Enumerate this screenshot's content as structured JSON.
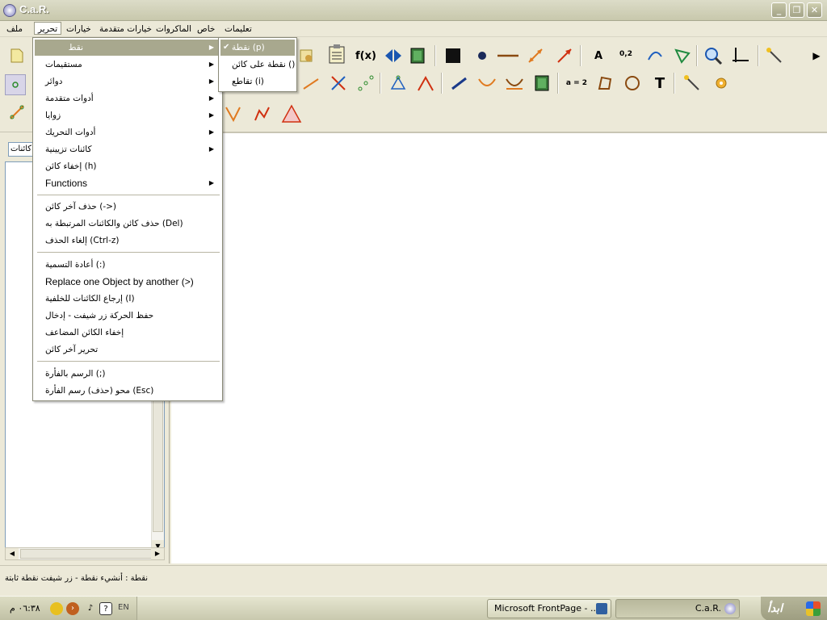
{
  "window": {
    "title": "C.a.R.",
    "buttons": {
      "minimize": "_",
      "maximize": "❐",
      "close": "✕"
    }
  },
  "menubar": {
    "items": [
      {
        "id": "file",
        "label": "ملف"
      },
      {
        "id": "edit",
        "label": "تحرير"
      },
      {
        "id": "options",
        "label": "خيارات"
      },
      {
        "id": "advanced_options",
        "label": "خيارات متقدمة"
      },
      {
        "id": "macros",
        "label": "الماكروات"
      },
      {
        "id": "special",
        "label": "خاص"
      },
      {
        "id": "help",
        "label": "تعليمات"
      }
    ]
  },
  "edit_menu": {
    "items": [
      {
        "label": "نقط",
        "submenu": true,
        "highlighted": true
      },
      {
        "label": "مستقيمات",
        "submenu": true
      },
      {
        "label": "دوائر",
        "submenu": true
      },
      {
        "label": "أدوات متقدمة",
        "submenu": true
      },
      {
        "label": "زوايا",
        "submenu": true
      },
      {
        "label": "أدوات التحريك",
        "submenu": true
      },
      {
        "label": "كائنات تزيينية",
        "submenu": true
      },
      {
        "label": "إخفاء كائن (h)"
      },
      {
        "label": "Functions",
        "submenu": true
      }
    ],
    "group2": [
      {
        "label": "حذف آخر كائن       (->)"
      },
      {
        "label": "حذف كائن والكائنات المرتبطة به (Del)"
      },
      {
        "label": "إلغاء الحذف       (Ctrl-z)"
      }
    ],
    "group3": [
      {
        "label": "أعادة التسمية (:)"
      },
      {
        "label": "Replace one Object by another (>)"
      },
      {
        "label": "إرجاع الكائنات للخلفية (I)"
      },
      {
        "label": "حفظ الحركة زر شيفت - إدخال"
      },
      {
        "label": "إخفاء الكائن المضاعف"
      },
      {
        "label": "تحرير آخر كائن"
      }
    ],
    "group4": [
      {
        "label": "الرسم بالفأرة (;)"
      },
      {
        "label": "محو (حذف) رسم الفأرة      (Esc)"
      }
    ]
  },
  "points_submenu": {
    "items": [
      {
        "label": "نقطة (p)",
        "checked": true,
        "highlighted": true
      },
      {
        "label": "نقطة على كائن ()"
      },
      {
        "label": "تقاطع (i)"
      }
    ]
  },
  "toolbar": {
    "fx_label": "f(x)",
    "label_tool": "A",
    "number_tool": "0,2",
    "equation_tool": "a = 2",
    "text_tool": "T",
    "more_arrow": "▶"
  },
  "left_panel": {
    "select_value": "كائنات"
  },
  "status": {
    "text": "نقطة : أنشيء نقطة - زر شيفت نقطة ثابتة"
  },
  "taskbar": {
    "start_label": "ابدأ",
    "clock": "٠٦:٣٨ م",
    "lang": "EN",
    "tasks": [
      {
        "label": "Microsoft FrontPage - ...",
        "active": false
      },
      {
        "label": "C.a.R.",
        "active": true
      }
    ]
  },
  "colors": {
    "menu_highlight": "#a8a88e",
    "title_bg": "#c8c8ac",
    "chrome": "#ece9d8"
  }
}
